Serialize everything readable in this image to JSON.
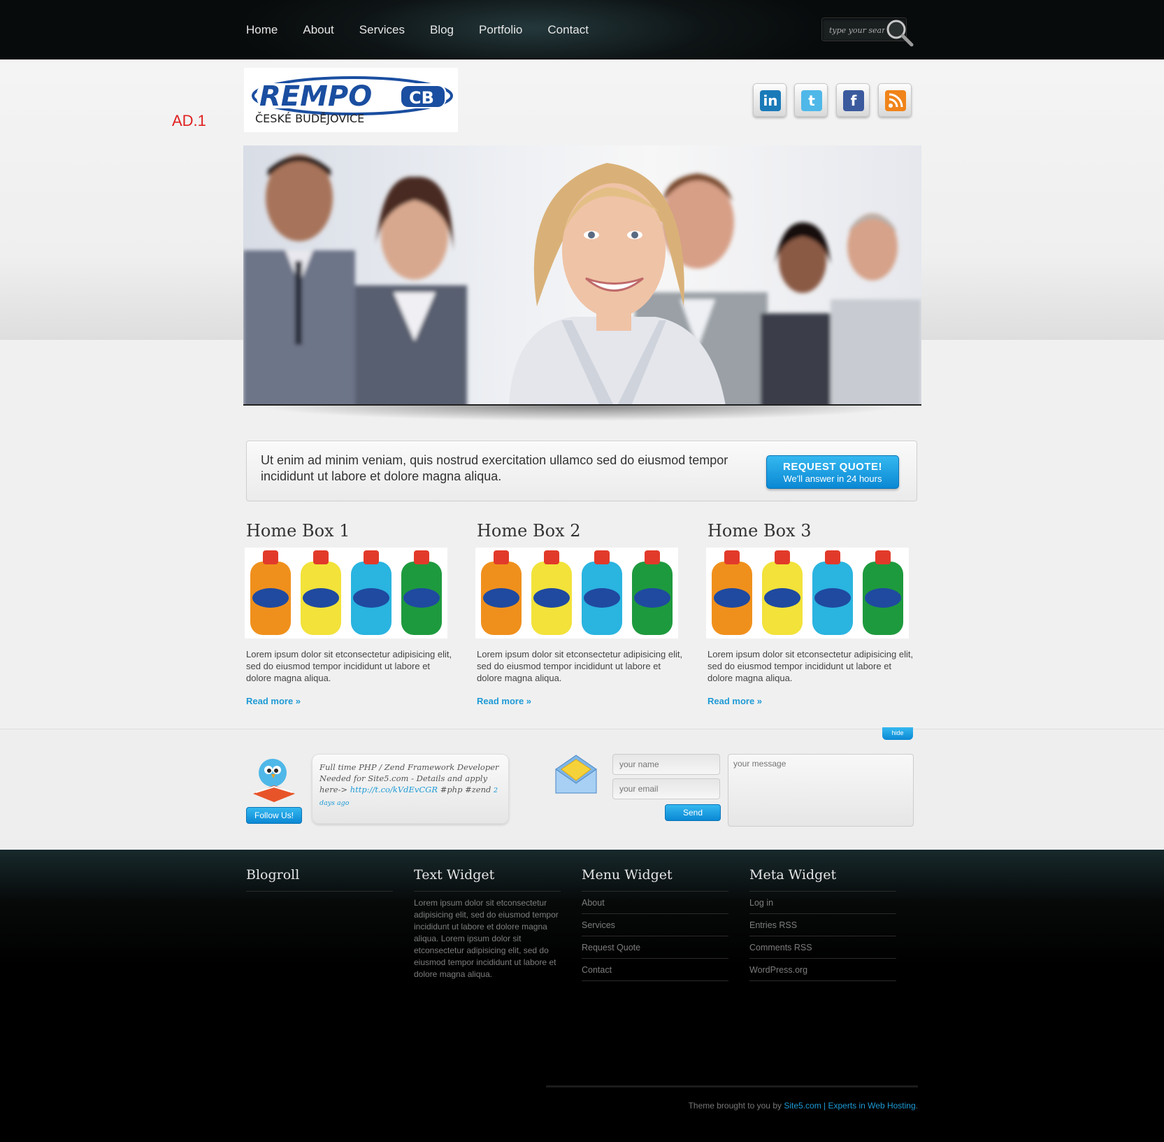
{
  "nav": {
    "items": [
      "Home",
      "About",
      "Services",
      "Blog",
      "Portfolio",
      "Contact"
    ],
    "search_placeholder": "type your search"
  },
  "header": {
    "ad_label": "AD.1",
    "logo_text": "REMPO",
    "logo_suffix": "CB",
    "logo_sub": "ČESKÉ BUDĚJOVICE",
    "social": [
      "linkedin-icon",
      "twitter-icon",
      "facebook-icon",
      "rss-icon"
    ]
  },
  "quote": {
    "text": "Ut enim ad minim veniam, quis nostrud exercitation ullamco sed do eiusmod tempor incididunt ut labore et dolore magna aliqua.",
    "button_line1": "REQUEST QUOTE!",
    "button_line2": "We'll answer in 24 hours"
  },
  "home_boxes": [
    {
      "title": "Home Box 1",
      "text": "Lorem ipsum dolor sit etconsectetur adipisicing elit, sed do eiusmod tempor incididunt ut labore et dolore magna aliqua.",
      "link": "Read more »"
    },
    {
      "title": "Home Box 2",
      "text": "Lorem ipsum dolor sit etconsectetur adipisicing elit, sed do eiusmod tempor incididunt ut labore et dolore magna aliqua.",
      "link": "Read more »"
    },
    {
      "title": "Home Box 3",
      "text": "Lorem ipsum dolor sit etconsectetur adipisicing elit, sed do eiusmod tempor incididunt ut labore et dolore magna aliqua.",
      "link": "Read more »"
    }
  ],
  "contact": {
    "hide_label": "hide",
    "follow_label": "Follow Us!",
    "tweet_text": "Full time PHP / Zend Framework Developer Needed for Site5.com - Details and apply here->",
    "tweet_link": "http://t.co/kVdEvCGR",
    "tweet_tags": "#php #zend",
    "tweet_ago": "2 days ago",
    "name_placeholder": "your name",
    "email_placeholder": "your email",
    "message_placeholder": "your message",
    "send_label": "Send"
  },
  "footer": {
    "blogroll_title": "Blogroll",
    "text_widget_title": "Text Widget",
    "text_widget_body": "Lorem ipsum dolor sit etconsectetur adipisicing elit, sed do eiusmod tempor incididunt ut labore et dolore magna aliqua. Lorem ipsum dolor sit etconsectetur adipisicing elit, sed do eiusmod tempor incididunt ut labore et dolore magna aliqua.",
    "menu_widget_title": "Menu Widget",
    "menu_items": [
      "About",
      "Services",
      "Request Quote",
      "Contact"
    ],
    "meta_widget_title": "Meta Widget",
    "meta_items": [
      "Log in",
      "Entries RSS",
      "Comments RSS",
      "WordPress.org"
    ],
    "credit_prefix": "Theme brought to you by",
    "credit_link": "Site5.com | Experts in Web Hosting",
    "credit_suffix": "."
  },
  "colors": {
    "accent": "#1d9ad6",
    "ad_label": "#e02020",
    "footer_bg": "#000000"
  }
}
